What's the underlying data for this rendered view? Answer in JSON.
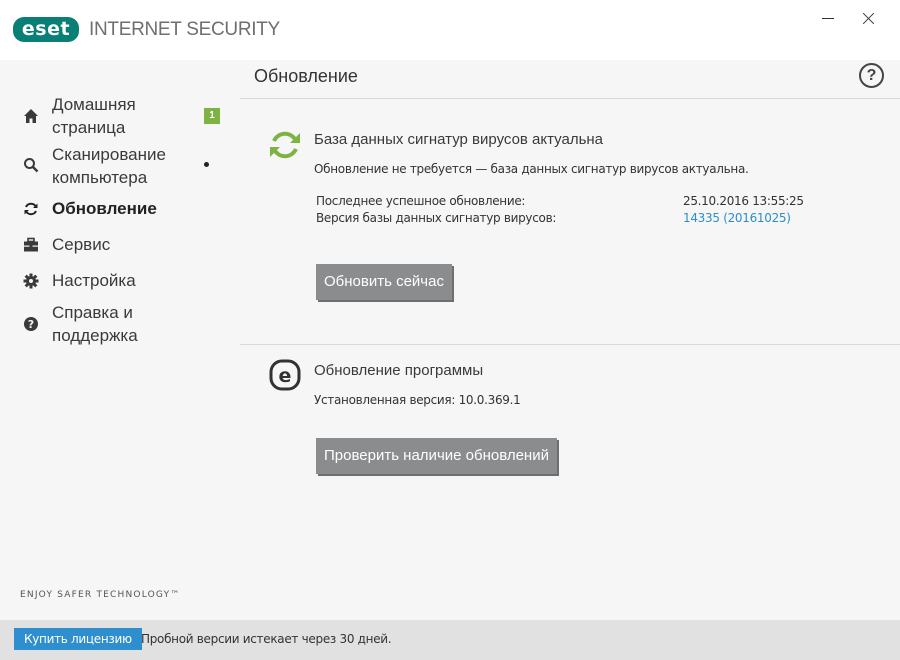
{
  "app": {
    "logo_text": "eset",
    "product_name": "INTERNET SECURITY"
  },
  "window": {
    "minimize_icon": "minimize-icon",
    "close_icon": "close-icon"
  },
  "sidebar": {
    "items": [
      {
        "label_line1": "Домашняя",
        "label_line2": "страница",
        "icon": "home-icon",
        "badge": "1"
      },
      {
        "label_line1": "Сканирование",
        "label_line2": "компьютера",
        "icon": "magnifier-icon"
      },
      {
        "label": "Обновление",
        "icon": "refresh-icon",
        "active": true
      },
      {
        "label": "Сервис",
        "icon": "toolbox-icon"
      },
      {
        "label": "Настройка",
        "icon": "gear-icon"
      },
      {
        "label_line1": "Справка и",
        "label_line2": "поддержка",
        "icon": "help-circle-icon"
      }
    ],
    "slogan": "ENJOY SAFER TECHNOLOGY™"
  },
  "main": {
    "title": "Обновление",
    "help_label": "?",
    "signatures": {
      "title": "База данных сигнатур вирусов актуальна",
      "message": "Обновление не требуется — база данных сигнатур вирусов актуальна.",
      "last_update_label": "Последнее успешное обновление:",
      "last_update_value": "25.10.2016 13:55:25",
      "version_label": "Версия базы данных сигнатур вирусов:",
      "version_value": "14335 (20161025)",
      "update_button": "Обновить сейчас"
    },
    "program": {
      "title": "Обновление программы",
      "installed_version": "Установленная версия: 10.0.369.1",
      "check_button": "Проверить наличие обновлений"
    }
  },
  "statusbar": {
    "buy_button": "Купить лицензию",
    "trial_text": "Пробной версии истекает через 30 дней."
  },
  "colors": {
    "brand": "#0a7f76",
    "accent_green": "#7cb342",
    "link": "#2c8fc9",
    "button_gray": "#8b8c8e",
    "buy_blue": "#2f8fce"
  }
}
